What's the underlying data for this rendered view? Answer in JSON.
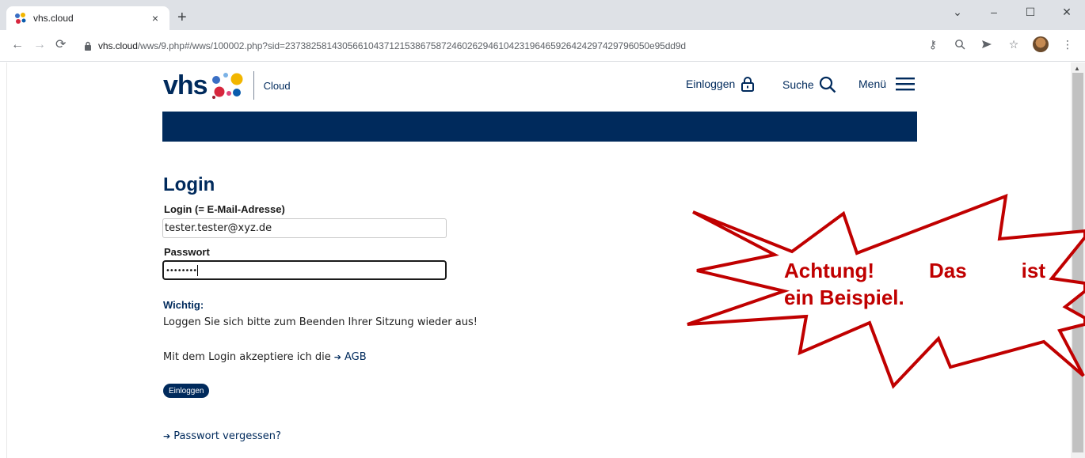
{
  "browser": {
    "tab_title": "vhs.cloud",
    "tab_close": "×",
    "new_tab": "+",
    "url_host": "vhs.cloud",
    "url_path": "/wws/9.php#/wws/100002.php?sid=2373825814305661043712153867587246026294610423196465926424297429796050e95dd9d",
    "controls": {
      "minimize": "–",
      "maximize": "☐",
      "close": "✕",
      "chevron": "⌄"
    }
  },
  "site": {
    "logo_text": "vhs",
    "logo_sub": "Cloud",
    "nav": {
      "login": "Einloggen",
      "search": "Suche",
      "menu": "Menü"
    },
    "brand_color": "#002a5c"
  },
  "login": {
    "title": "Login",
    "email_label": "Login (= E-Mail-Adresse)",
    "email_value": "tester.tester@xyz.de",
    "password_label": "Passwort",
    "password_value": "••••••••",
    "important_heading": "Wichtig:",
    "important_text": "Loggen Sie sich bitte zum Beenden Ihrer Sitzung wieder aus!",
    "terms_text": "Mit dem Login akzeptiere ich die",
    "terms_link": "AGB",
    "submit_label": "Einloggen",
    "forgot_link": "Passwort vergessen?"
  },
  "annotation": {
    "line1_words": [
      "Achtung!",
      "Das",
      "ist"
    ],
    "line2": "ein Beispiel.",
    "text_color": "#c00000",
    "outline_color": "#c00000"
  }
}
